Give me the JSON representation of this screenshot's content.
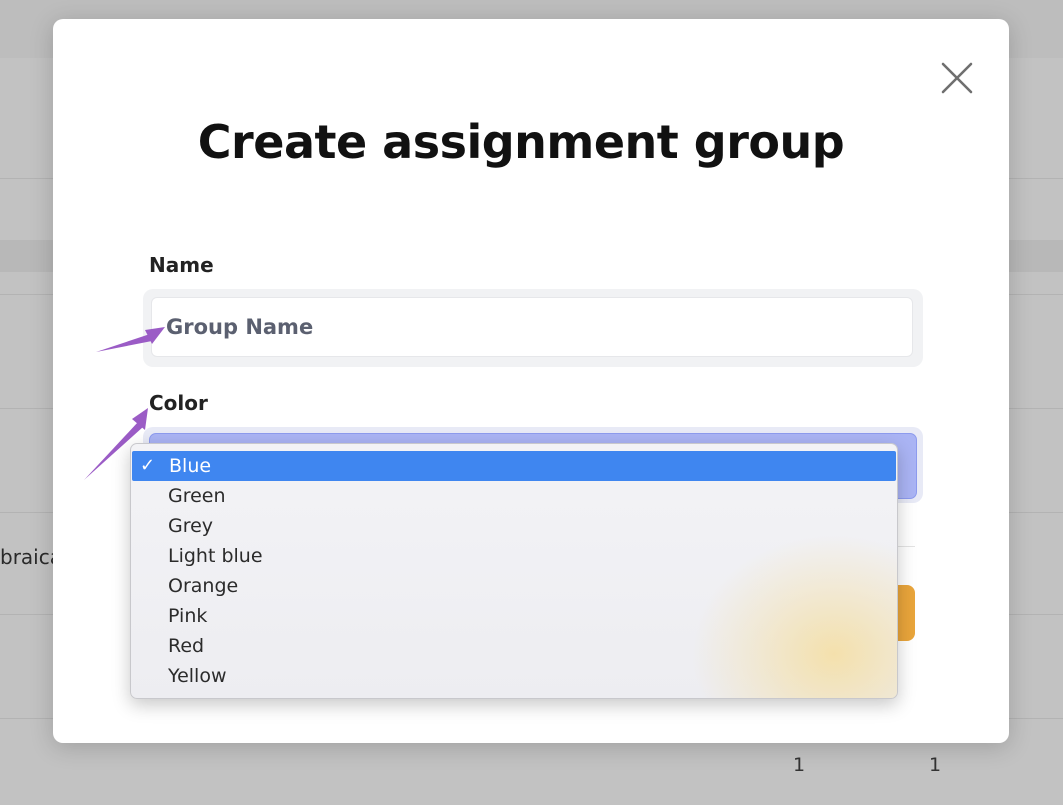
{
  "background": {
    "side_text": "braica",
    "counts": [
      "1",
      "1"
    ]
  },
  "modal": {
    "title": "Create assignment group",
    "close_icon": "close-icon",
    "name": {
      "label": "Name",
      "placeholder": "Group Name",
      "value": ""
    },
    "color": {
      "label": "Color",
      "selected": "Blue",
      "options": [
        "Blue",
        "Green",
        "Grey",
        "Light blue",
        "Orange",
        "Pink",
        "Red",
        "Yellow"
      ]
    }
  },
  "colors": {
    "selection_highlight": "#3f86f0",
    "submit_button": "#e9a53b",
    "annotation_arrow": "#9b5cc6"
  }
}
